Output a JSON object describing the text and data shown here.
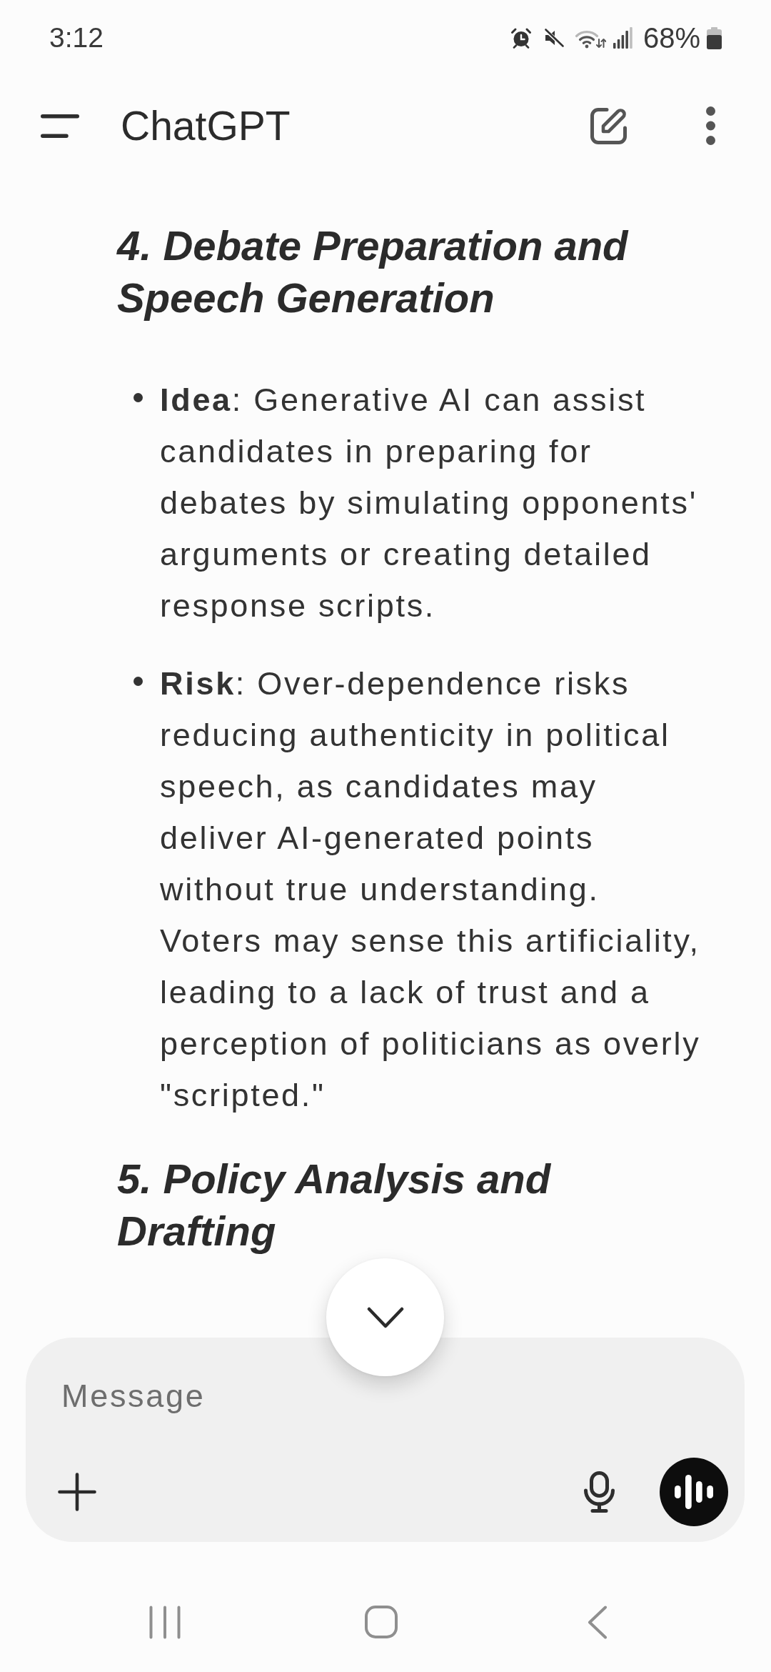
{
  "status_bar": {
    "time": "3:12",
    "battery_percent": "68%"
  },
  "app_bar": {
    "title": "ChatGPT"
  },
  "conversation": {
    "blocks": [
      {
        "kind": "heading",
        "text": "4. Debate Preparation and Speech Generation"
      },
      {
        "kind": "bullet_list",
        "items": [
          "**Idea**: Generative AI can assist candidates in preparing for debates by simulating opponents' arguments or creating detailed response scripts.",
          "**Risk**: Over-dependence risks reducing authenticity in political speech, as candidates may deliver AI-generated points without true understanding. Voters may sense this artificiality, leading to a lack of trust and a perception of politicians as overly \"scripted.\""
        ]
      },
      {
        "kind": "heading",
        "text": "5. Policy Analysis and Drafting"
      }
    ]
  },
  "composer": {
    "placeholder": "Message"
  }
}
